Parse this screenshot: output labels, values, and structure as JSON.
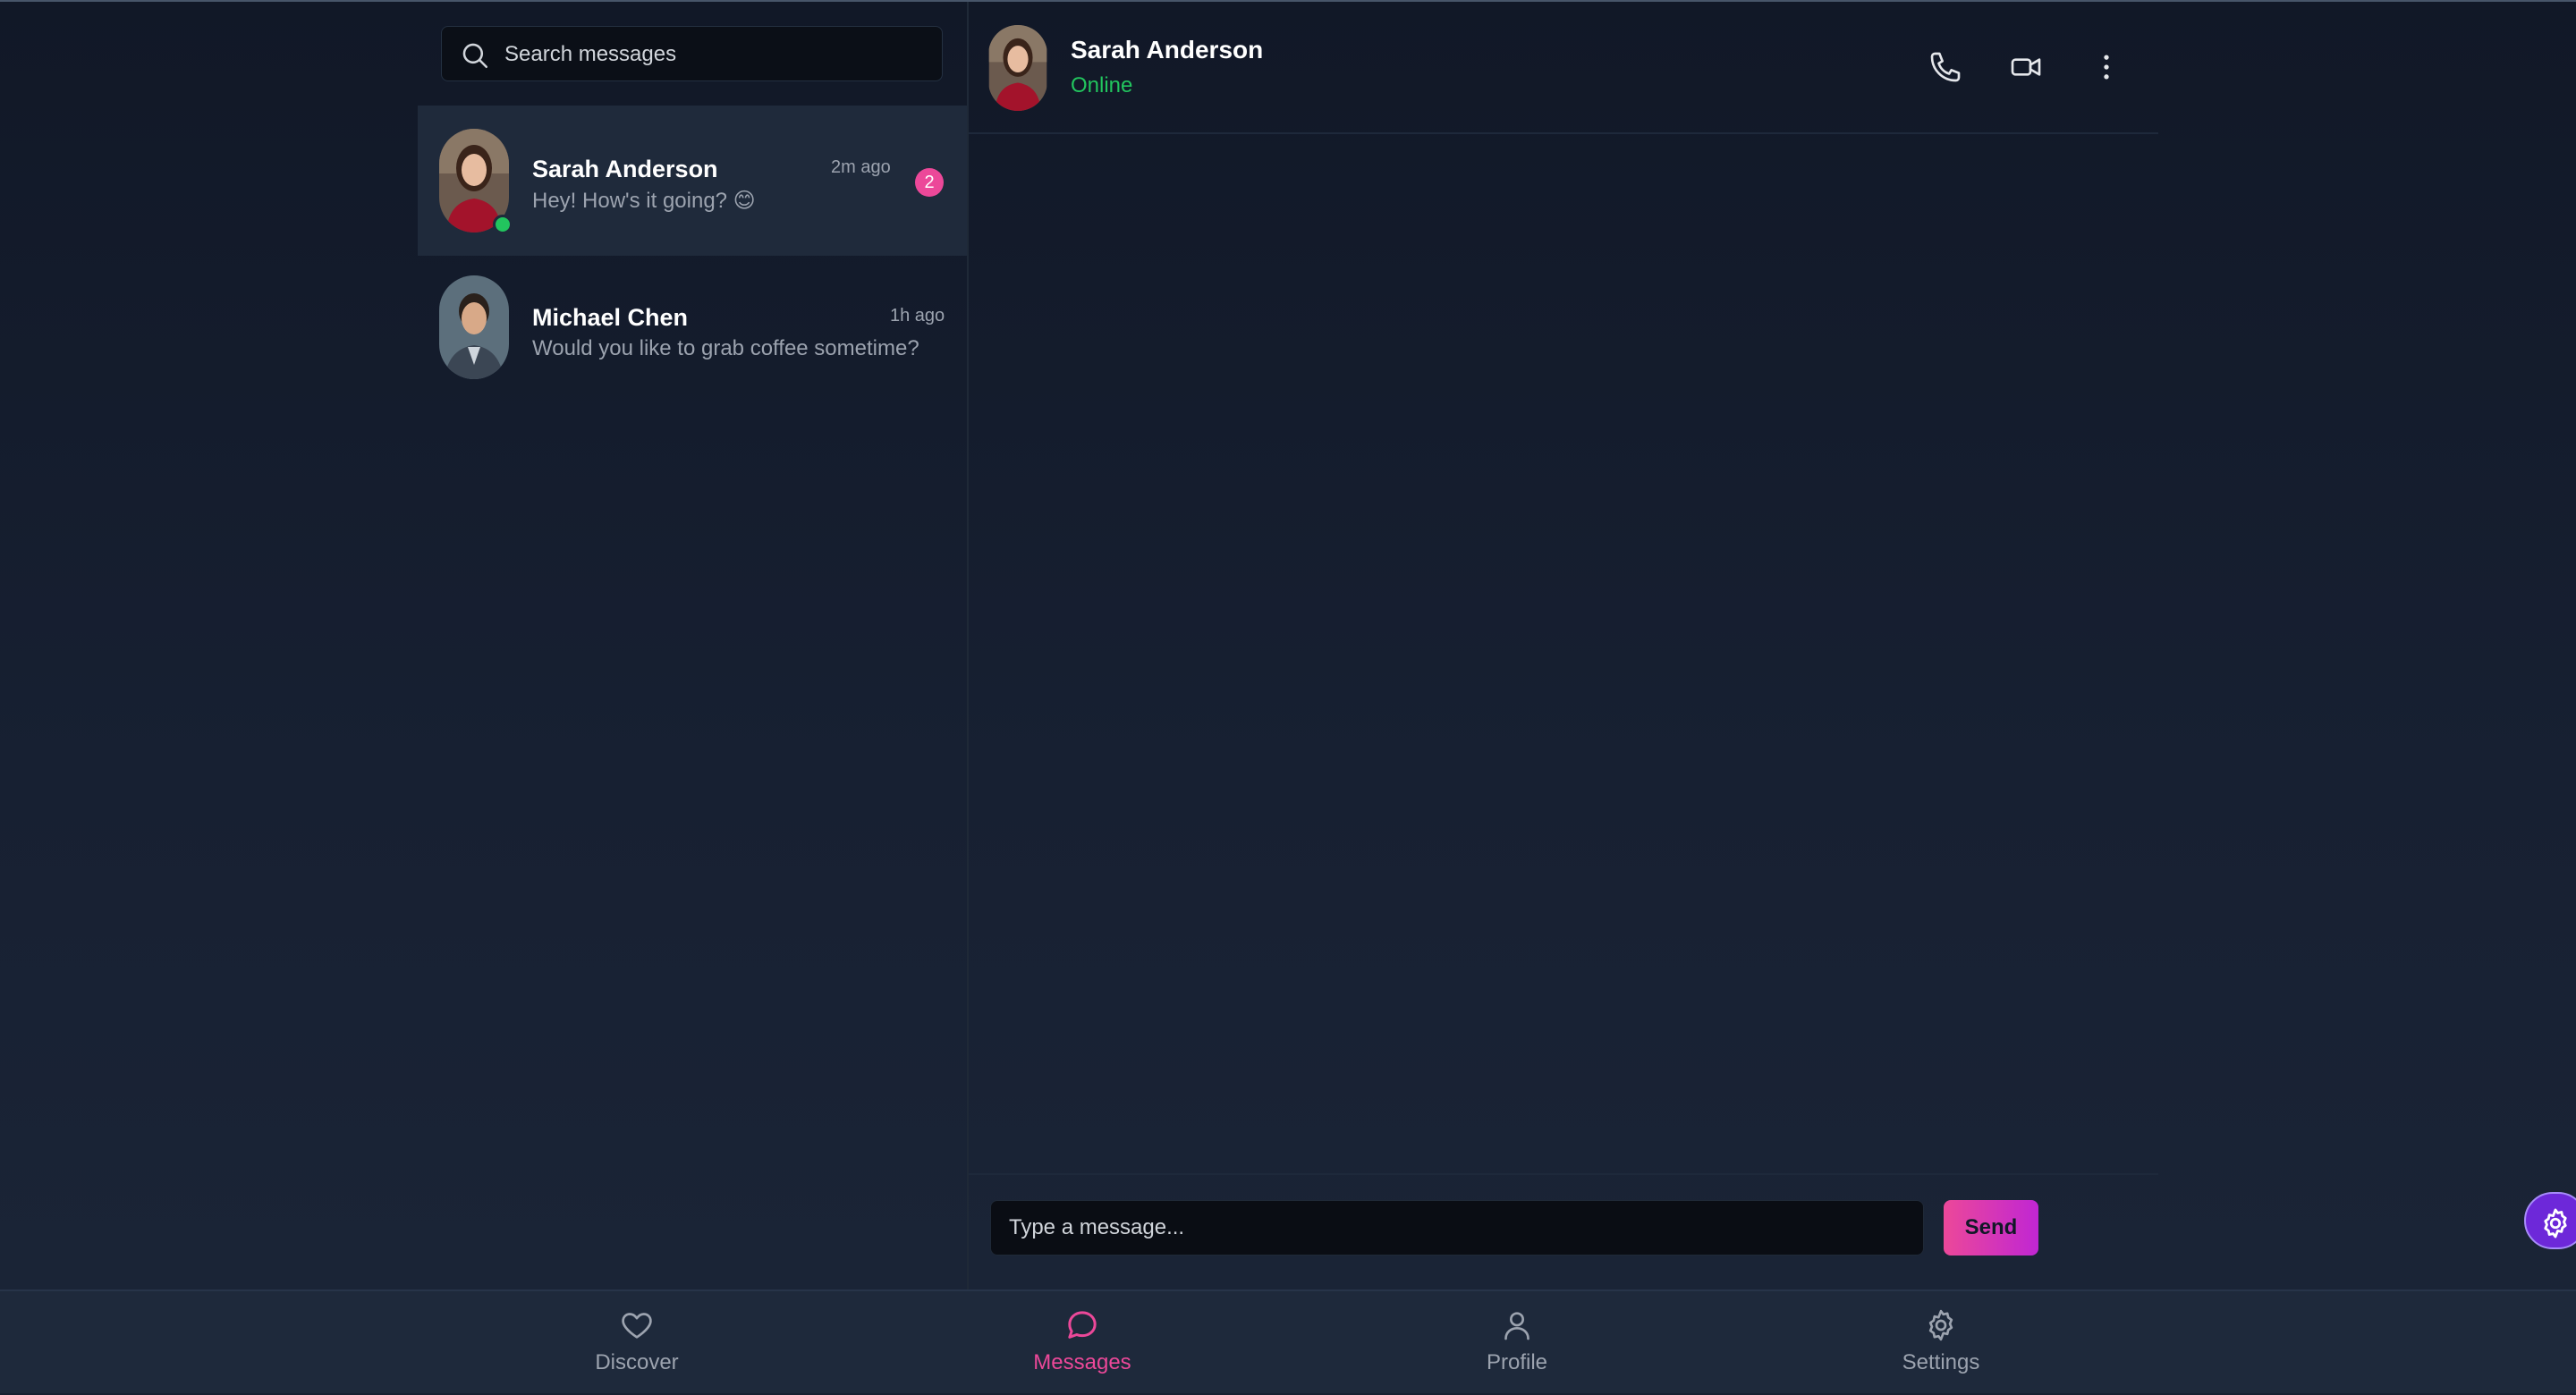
{
  "search": {
    "placeholder": "Search messages"
  },
  "conversations": [
    {
      "name": "Sarah Anderson",
      "preview": "Hey! How's it going? 😊",
      "time": "2m ago",
      "unread": "2",
      "online": true
    },
    {
      "name": "Michael Chen",
      "preview": "Would you like to grab coffee sometime?",
      "time": "1h ago"
    }
  ],
  "chat": {
    "name": "Sarah Anderson",
    "status": "Online",
    "input_placeholder": "Type a message...",
    "send_label": "Send"
  },
  "nav": {
    "items": [
      {
        "label": "Discover",
        "icon": "heart-icon"
      },
      {
        "label": "Messages",
        "icon": "chat-bubble-icon",
        "active": true
      },
      {
        "label": "Profile",
        "icon": "user-icon"
      },
      {
        "label": "Settings",
        "icon": "gear-icon"
      }
    ]
  },
  "colors": {
    "accent": "#ec4899",
    "online": "#22c55e",
    "background": "#172031"
  }
}
